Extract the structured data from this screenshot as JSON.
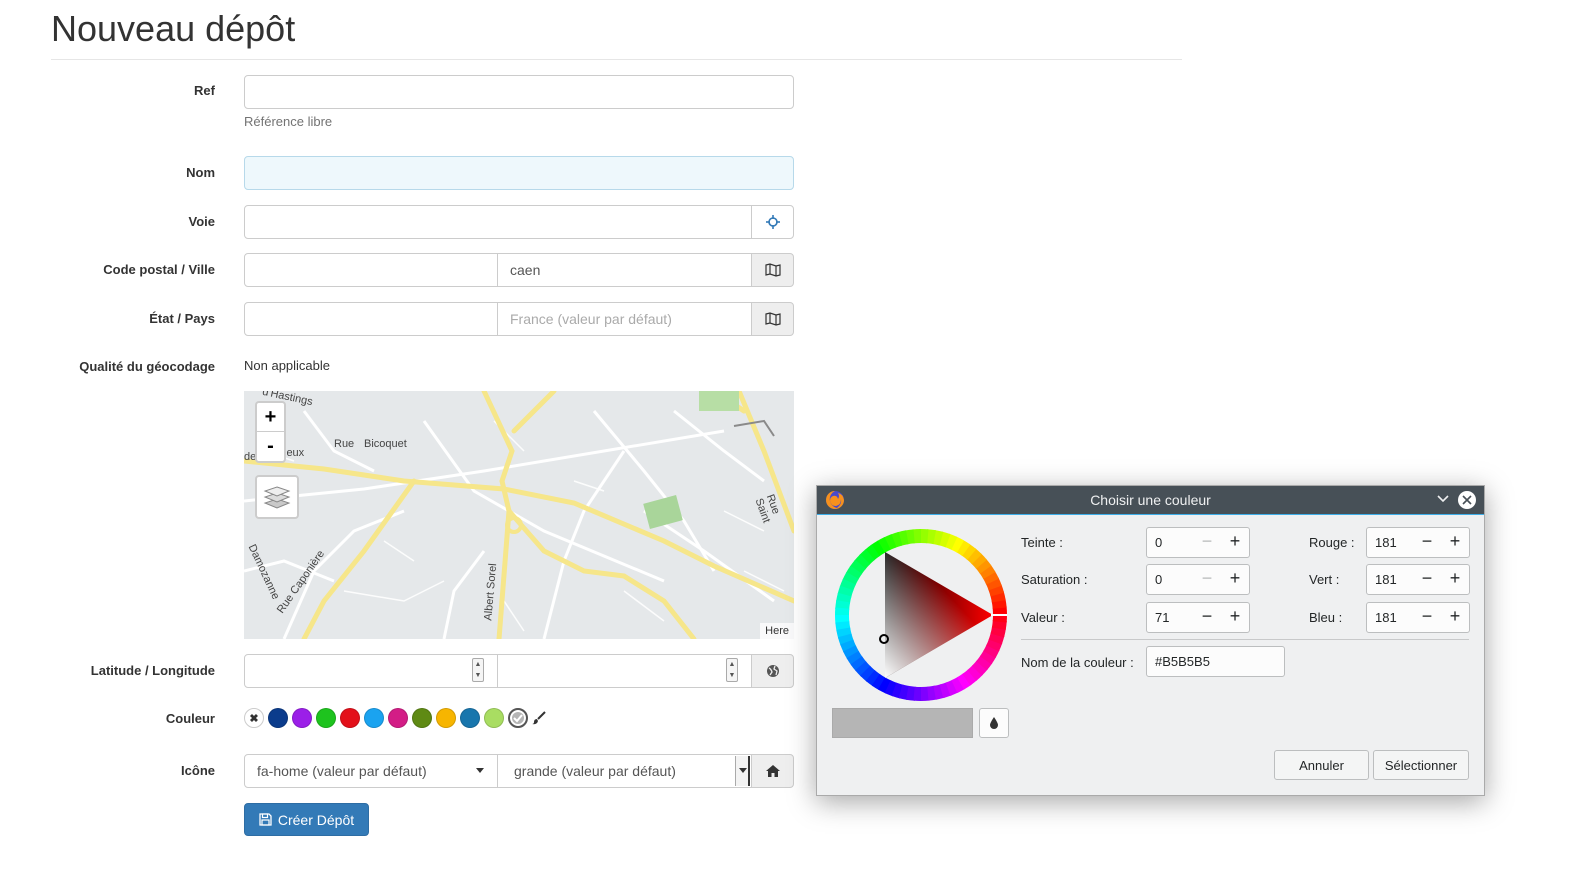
{
  "page": {
    "title": "Nouveau dépôt"
  },
  "form": {
    "ref": {
      "label": "Ref",
      "value": "",
      "help": "Référence libre"
    },
    "nom": {
      "label": "Nom",
      "value": ""
    },
    "voie": {
      "label": "Voie",
      "value": "",
      "icon": "crosshairs-icon"
    },
    "code_postal_ville": {
      "label": "Code postal / Ville",
      "postal_value": "",
      "ville_value": "caen",
      "icon": "map-icon"
    },
    "etat_pays": {
      "label": "État / Pays",
      "etat_value": "",
      "pays_placeholder": "France (valeur par défaut)",
      "icon": "map-icon"
    },
    "qualite": {
      "label": "Qualité du géocodage",
      "value": "Non applicable"
    },
    "map": {
      "zoom_in": "+",
      "zoom_out": "-",
      "attribution": "Here",
      "streets": [
        "d'Hastings",
        "Rue",
        "Bicoquet",
        "de",
        "jeux",
        "Rue Saint",
        "Damozanne",
        "Rue Caponière",
        "Albert Sorel"
      ]
    },
    "lat_lng": {
      "label": "Latitude / Longitude",
      "lat_value": "",
      "lng_value": "",
      "icon": "globe-icon"
    },
    "couleur": {
      "label": "Couleur",
      "swatches": [
        "#0b3c8c",
        "#9b1fe8",
        "#1ec31e",
        "#e3101a",
        "#1aa3f0",
        "#d31d86",
        "#5f8a14",
        "#f7b500",
        "#1876ad",
        "#a9dd62"
      ],
      "selected_swatch": "#b5b5b5"
    },
    "icone": {
      "label": "Icône",
      "icon_value": "fa-home (valeur par défaut)",
      "size_value": "grande (valeur par défaut)",
      "icon": "home-icon"
    },
    "submit": {
      "label": "Créer Dépôt"
    }
  },
  "color_dialog": {
    "title": "Choisir une couleur",
    "teinte": {
      "label": "Teinte :",
      "value": "0"
    },
    "saturation": {
      "label": "Saturation :",
      "value": "0"
    },
    "valeur": {
      "label": "Valeur :",
      "value": "71"
    },
    "rouge": {
      "label": "Rouge :",
      "value": "181"
    },
    "vert": {
      "label": "Vert :",
      "value": "181"
    },
    "bleu": {
      "label": "Bleu :",
      "value": "181"
    },
    "nom": {
      "label": "Nom de la couleur :",
      "value": "#B5B5B5"
    },
    "preview_color": "#b5b5b5",
    "plus": "+",
    "minus": "−",
    "cancel": "Annuler",
    "select": "Sélectionner"
  }
}
